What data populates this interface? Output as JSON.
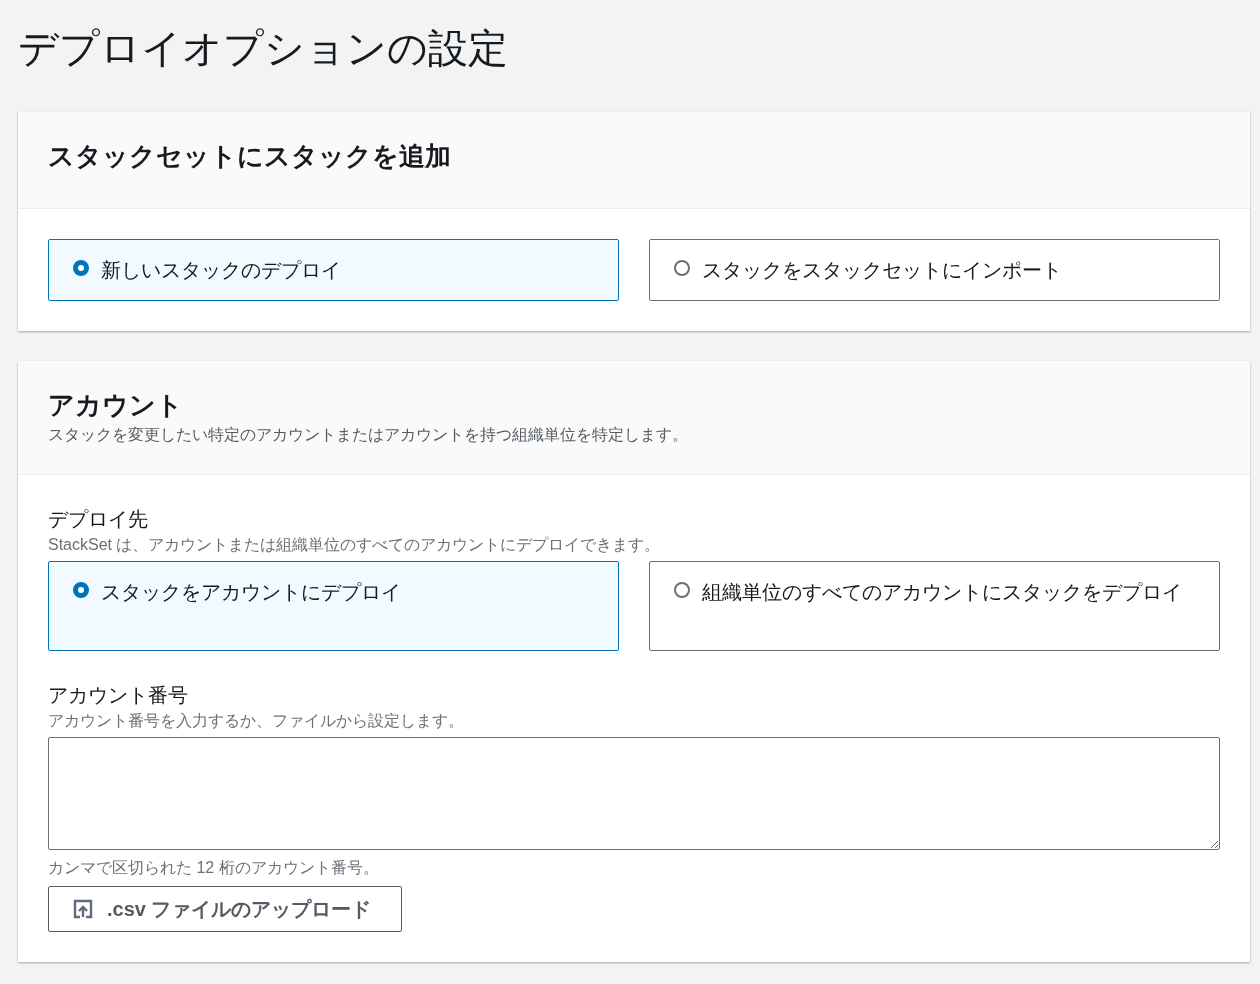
{
  "page_title": "デプロイオプションの設定",
  "sections": [
    {
      "kind": "choice",
      "title": "スタックセットにスタックを追加",
      "options": [
        {
          "label": "新しいスタックのデプロイ",
          "selected": true
        },
        {
          "label": "スタックをスタックセットにインポート",
          "selected": false
        }
      ]
    },
    {
      "kind": "account",
      "title": "アカウント",
      "description": "スタックを変更したい特定のアカウントまたはアカウントを持つ組織単位を特定します。",
      "deploy_target": {
        "label": "デプロイ先",
        "description": "StackSet は、アカウントまたは組織単位のすべてのアカウントにデプロイできます。",
        "options": [
          {
            "label": "スタックをアカウントにデプロイ",
            "selected": true
          },
          {
            "label": "組織単位のすべてのアカウントにスタックをデプロイ",
            "selected": false
          }
        ]
      },
      "account_numbers": {
        "label": "アカウント番号",
        "description": "アカウント番号を入力するか、ファイルから設定します。",
        "hint": "カンマで区切られた 12 桁のアカウント番号。",
        "upload_button": ".csv ファイルのアップロード"
      }
    }
  ]
}
